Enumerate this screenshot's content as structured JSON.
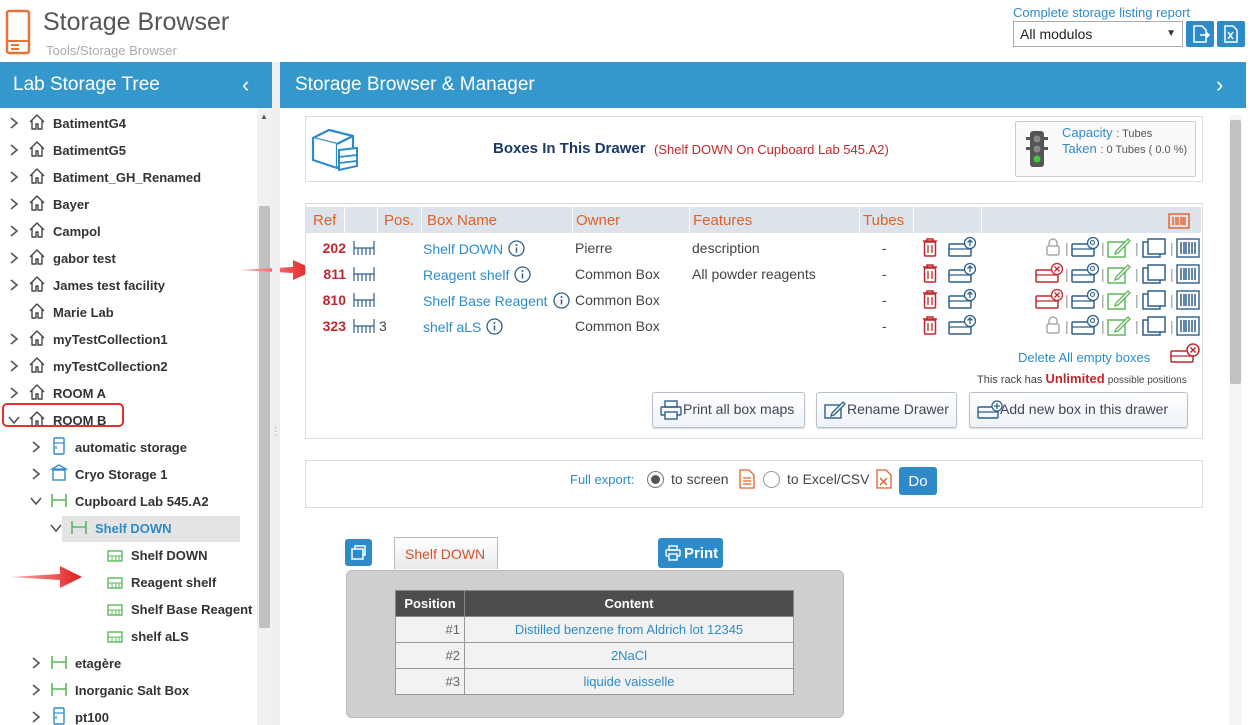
{
  "header": {
    "title": "Storage Browser",
    "breadcrumb": "Tools/Storage Browser",
    "report_link": "Complete storage listing report",
    "modulos_selected": "All modulos"
  },
  "left_panel": {
    "title": "Lab Storage Tree",
    "tree": [
      {
        "label": "BatimentG4",
        "icon": "home-icon",
        "level": 0,
        "expanded": false
      },
      {
        "label": "BatimentG5",
        "icon": "home-icon",
        "level": 0,
        "expanded": false
      },
      {
        "label": "Batiment_GH_Renamed",
        "icon": "home-icon",
        "level": 0,
        "expanded": false
      },
      {
        "label": "Bayer",
        "icon": "home-icon",
        "level": 0,
        "expanded": false
      },
      {
        "label": "Campol",
        "icon": "home-icon",
        "level": 0,
        "expanded": false
      },
      {
        "label": "gabor test",
        "icon": "home-icon",
        "level": 0,
        "expanded": false
      },
      {
        "label": "James test facility",
        "icon": "home-icon",
        "level": 0,
        "expanded": false
      },
      {
        "label": "Marie Lab",
        "icon": "home-icon",
        "level": 0,
        "expanded": false
      },
      {
        "label": "myTestCollection1",
        "icon": "home-icon",
        "level": 0,
        "expanded": false
      },
      {
        "label": "myTestCollection2",
        "icon": "home-icon",
        "level": 0,
        "expanded": false
      },
      {
        "label": "ROOM A",
        "icon": "home-icon",
        "level": 0,
        "expanded": false
      },
      {
        "label": "ROOM B",
        "icon": "home-icon",
        "level": 0,
        "expanded": true
      },
      {
        "label": "automatic storage",
        "icon": "fridge-icon",
        "level": 1,
        "expanded": false
      },
      {
        "label": "Cryo Storage 1",
        "icon": "cryo-icon",
        "level": 1,
        "expanded": false
      },
      {
        "label": "Cupboard Lab 545.A2",
        "icon": "cupboard-icon",
        "level": 1,
        "expanded": true
      },
      {
        "label": "Shelf DOWN",
        "icon": "shelf-icon",
        "level": 2,
        "expanded": true,
        "selected": true
      },
      {
        "label": "Shelf DOWN",
        "icon": "box-icon",
        "level": 3
      },
      {
        "label": "Reagent shelf",
        "icon": "box-icon",
        "level": 3
      },
      {
        "label": "Shelf Base Reagent",
        "icon": "box-icon",
        "level": 3
      },
      {
        "label": "shelf aLS",
        "icon": "box-icon",
        "level": 3
      },
      {
        "label": "etagère",
        "icon": "cupboard-icon",
        "level": 1,
        "expanded": false
      },
      {
        "label": "Inorganic Salt Box",
        "icon": "cupboard-icon",
        "level": 1,
        "expanded": false
      },
      {
        "label": "pt100",
        "icon": "fridge-icon",
        "level": 1,
        "expanded": false
      }
    ]
  },
  "right_panel": {
    "title": "Storage Browser & Manager",
    "drawer": {
      "title": "Boxes In This Drawer",
      "subtitle": "(Shelf DOWN On Cupboard Lab 545.A2)"
    },
    "capacity": {
      "capacity_label": "Capacity",
      "capacity_value": ": Tubes",
      "taken_label": "Taken",
      "taken_value": ": 0 Tubes ( 0.0 %)"
    },
    "table": {
      "headers": {
        "ref": "Ref",
        "pos": "Pos.",
        "name": "Box Name",
        "owner": "Owner",
        "features": "Features",
        "tubes": "Tubes"
      },
      "rows": [
        {
          "ref": "202",
          "pos": "",
          "name": "Shelf DOWN",
          "owner": "Pierre",
          "features": "description",
          "tubes": "-",
          "locked": true
        },
        {
          "ref": "811",
          "pos": "",
          "name": "Reagent shelf",
          "owner": "Common Box",
          "features": "All powder reagents",
          "tubes": "-",
          "locked": false
        },
        {
          "ref": "810",
          "pos": "",
          "name": "Shelf Base Reagent",
          "owner": "Common Box",
          "features": "",
          "tubes": "-",
          "locked": false
        },
        {
          "ref": "323",
          "pos": "3",
          "name": "shelf aLS",
          "owner": "Common Box",
          "features": "",
          "tubes": "-",
          "locked": true
        }
      ]
    },
    "delete_empty": "Delete All empty boxes",
    "rack_note_pre": "This rack has",
    "rack_note_value": "Unlimited",
    "rack_note_post": "possible positions",
    "buttons": {
      "print_maps": "Print all box maps",
      "rename_drawer": "Rename Drawer",
      "add_box": "Add new box in this drawer"
    },
    "export": {
      "label": "Full export:",
      "opt_screen": "to screen",
      "opt_excel": "to Excel/CSV",
      "do": "Do",
      "selected": "to screen"
    },
    "box_map": {
      "tab": "Shelf DOWN",
      "print": "Print",
      "headers": {
        "position": "Position",
        "content": "Content"
      },
      "rows": [
        {
          "position": "#1",
          "content": "Distilled benzene from Aldrich lot 12345"
        },
        {
          "position": "#2",
          "content": "2NaCl"
        },
        {
          "position": "#3",
          "content": "liquide vaisselle"
        }
      ]
    }
  },
  "colors": {
    "accent": "#3598cd",
    "ref_red": "#c0282d",
    "link_blue": "#2e8bc9",
    "header_orange": "#e06026"
  }
}
